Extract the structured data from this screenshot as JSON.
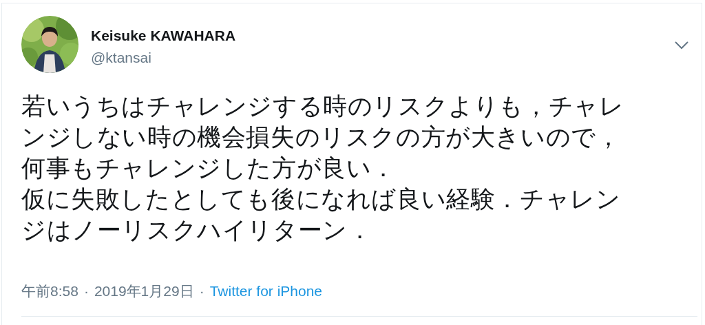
{
  "author": {
    "name": "Keisuke KAWAHARA",
    "handle": "@ktansai"
  },
  "paragraphs": [
    "若いうちはチャレンジする時のリスクよりも，チャレンジしない時の機会損失のリスクの方が大きいので，何事もチャレンジした方が良い．",
    "仮に失敗したとしても後になれば良い経験．チャレンジはノーリスクハイリターン．"
  ],
  "meta": {
    "time": "午前8:58",
    "separator": "·",
    "date": "2019年1月29日",
    "source": "Twitter for iPhone"
  }
}
